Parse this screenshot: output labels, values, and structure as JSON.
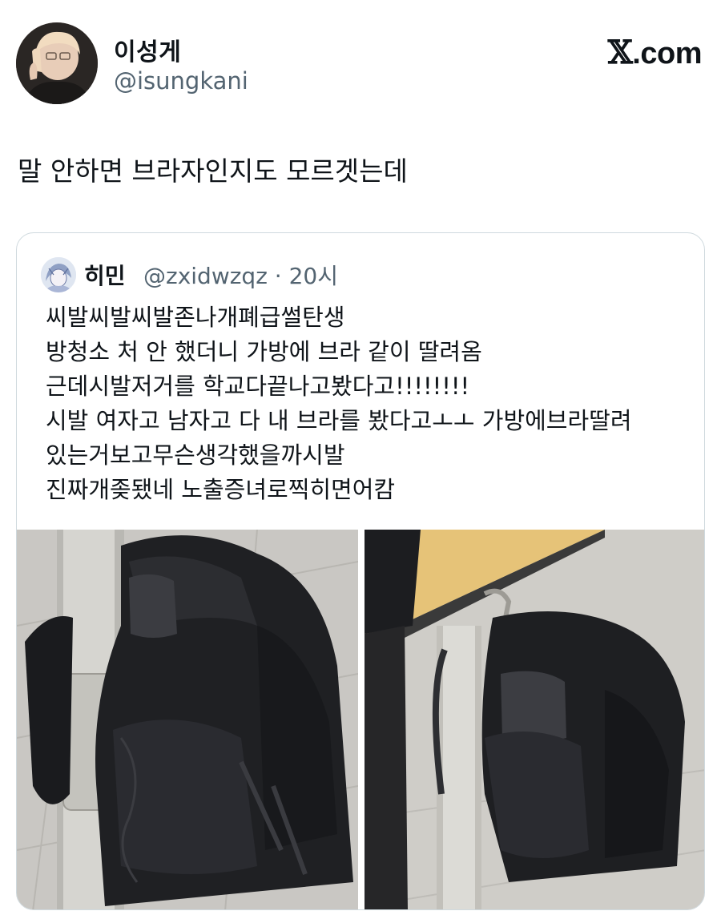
{
  "author": {
    "display_name": "이성게",
    "handle": "@isungkani",
    "avatar_icon": "profile-photo-icon"
  },
  "brand": {
    "logo_x": "𝕏",
    "logo_rest": ".com"
  },
  "tweet": {
    "text": "말 안하면 브라자인지도 모르겟는데"
  },
  "quoted_tweet": {
    "display_name": "히민",
    "handle_time": "@zxidwzqz · 20시",
    "avatar_icon": "anime-avatar-icon",
    "lines": [
      "씨발씨발씨발존나개폐급썰탄생",
      "방청소 처 안 했더니 가방에 브라 같이 딸려옴",
      "근데시발저거를 학교다끝나고봤다고!!!!!!!!",
      "시발 여자고 남자고 다 내 브라를 봤다고ㅗㅗ 가방에브라딸려",
      "있는거보고무슨생각했을까시발",
      "진짜개좆됐네 노출증녀로찍히면어캄"
    ],
    "photos": [
      {
        "icon": "backpack-photo-icon"
      },
      {
        "icon": "backpack-photo-icon"
      }
    ]
  },
  "colors": {
    "text_primary": "#0f1419",
    "text_secondary": "#536471",
    "border": "#cfd9de",
    "background": "#ffffff"
  }
}
